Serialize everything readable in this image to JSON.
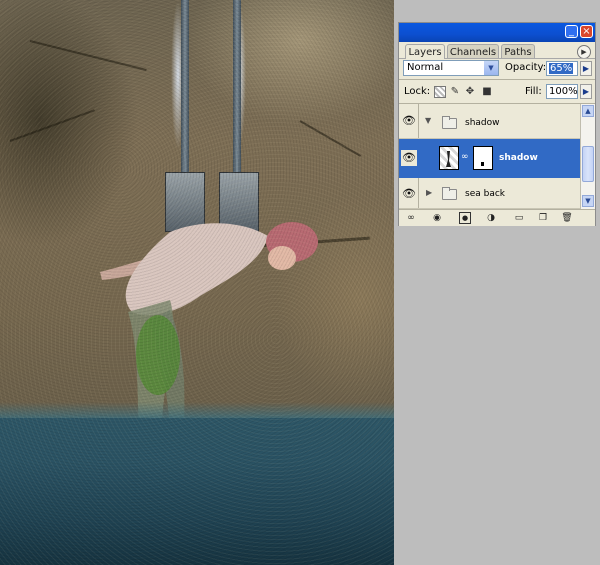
{
  "palette": {
    "tabs": [
      {
        "label": "Layers",
        "active": true
      },
      {
        "label": "Channels",
        "active": false
      },
      {
        "label": "Paths",
        "active": false
      }
    ],
    "titlebar_buttons": {
      "minimize": "_",
      "close": "×"
    },
    "blend_mode": "Normal",
    "opacity_label": "Opacity:",
    "opacity_value": "65%",
    "lock_label": "Lock:",
    "fill_label": "Fill:",
    "fill_value": "100%",
    "layers": [
      {
        "name": "shadow",
        "type": "group",
        "expanded": true,
        "selected": false
      },
      {
        "name": "shadow",
        "type": "layer",
        "selected": true,
        "has_mask": true
      },
      {
        "name": "sea back",
        "type": "group",
        "expanded": false,
        "selected": false
      }
    ],
    "bottom_icons": [
      "link-icon",
      "fx-icon",
      "mask-icon",
      "adjustment-icon",
      "new-group-icon",
      "new-layer-icon",
      "trash-icon"
    ]
  },
  "colors": {
    "titlebar": "#0c4fd0",
    "selected_row": "#316ac5",
    "panel_bg": "#ece9d8",
    "water": "#2a5263"
  }
}
